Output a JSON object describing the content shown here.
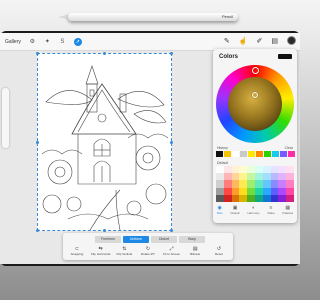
{
  "pencil": {
    "label": "Pencil"
  },
  "toolbar": {
    "gallery_label": "Gallery",
    "left_icons": [
      "wrench-icon",
      "magic-wand-icon",
      "selection-icon",
      "transform-icon"
    ],
    "right_icons": [
      "brush-icon",
      "smudge-icon",
      "eraser-icon",
      "layers-icon"
    ],
    "active_color": "#2a2a2a"
  },
  "colors_panel": {
    "title": "Colors",
    "current_color": "#111111",
    "history_label": "History",
    "history_clear": "Clear",
    "history": [
      "#111111",
      "#f4c400",
      "#ffffff",
      "#c9c9c9",
      "#ffe800",
      "#ff8a00",
      "#2bd100",
      "#19c9e8",
      "#7b58ff",
      "#ff2fa6"
    ],
    "default_label": "Default",
    "palette": [
      "#ffffff",
      "#ffe6e6",
      "#fff1d6",
      "#fffbd0",
      "#e9ffd8",
      "#d8fff3",
      "#d8f2ff",
      "#e3e3ff",
      "#f3deff",
      "#ffdff0",
      "#e9e9e9",
      "#ffb5b5",
      "#ffd59a",
      "#fff38e",
      "#c5f7a0",
      "#9ef5dc",
      "#a3ddff",
      "#b8b8ff",
      "#e0b2ff",
      "#ffb2da",
      "#cfcfcf",
      "#ff7d7d",
      "#ffb862",
      "#ffea52",
      "#9fef6c",
      "#5fe8c2",
      "#63c6ff",
      "#8a8aff",
      "#c97dff",
      "#ff7dc2",
      "#9e9e9e",
      "#ff4747",
      "#ff9a2d",
      "#ffdc1e",
      "#72dc3a",
      "#20d6a6",
      "#2aa8ff",
      "#5e5eff",
      "#ae48ff",
      "#ff48a6",
      "#5a5a5a",
      "#d32020",
      "#d9720c",
      "#d8b400",
      "#4fb21c",
      "#0ea982",
      "#1178d4",
      "#3333d0",
      "#8420d8",
      "#d4207e"
    ],
    "tabs": [
      {
        "icon": "disc-icon",
        "label": "Disc"
      },
      {
        "icon": "classic-icon",
        "label": "Classic"
      },
      {
        "icon": "harmony-icon",
        "label": "Harmony"
      },
      {
        "icon": "value-icon",
        "label": "Value"
      },
      {
        "icon": "palettes-icon",
        "label": "Palettes"
      }
    ]
  },
  "transform": {
    "modes": [
      "Freeform",
      "Uniform",
      "Distort",
      "Warp"
    ],
    "active_mode": 1,
    "actions": [
      {
        "icon": "magnet-icon",
        "label": "Snapping"
      },
      {
        "icon": "flip-horizontal-icon",
        "label": "Flip Horizontal"
      },
      {
        "icon": "flip-vertical-icon",
        "label": "Flip Vertical"
      },
      {
        "icon": "rotate-icon",
        "label": "Rotate 45°"
      },
      {
        "icon": "fit-screen-icon",
        "label": "Fit to Screen"
      },
      {
        "icon": "interpolation-icon",
        "label": "Bilinear"
      },
      {
        "icon": "reset-icon",
        "label": "Reset"
      }
    ]
  }
}
